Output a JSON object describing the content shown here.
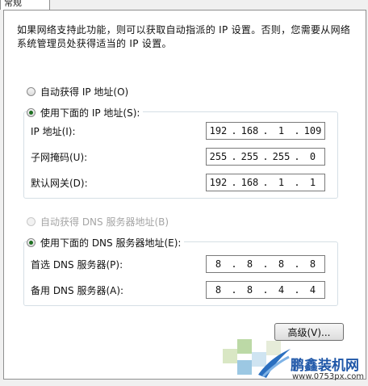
{
  "tab": {
    "label": "常规"
  },
  "description": "如果网络支持此功能，则可以获取自动指派的 IP 设置。否则，您需要从网络系统管理员处获得适当的 IP 设置。",
  "ip": {
    "auto_label": "自动获得 IP 地址(O)",
    "manual_label": "使用下面的 IP 地址(S):",
    "fields": [
      {
        "label": "IP 地址(I):",
        "octets": [
          "192",
          "168",
          "1",
          "109"
        ]
      },
      {
        "label": "子网掩码(U):",
        "octets": [
          "255",
          "255",
          "255",
          "0"
        ]
      },
      {
        "label": "默认网关(D):",
        "octets": [
          "192",
          "168",
          "1",
          "1"
        ]
      }
    ]
  },
  "dns": {
    "auto_label": "自动获得 DNS 服务器地址(B)",
    "manual_label": "使用下面的 DNS 服务器地址(E):",
    "fields": [
      {
        "label": "首选 DNS 服务器(P):",
        "octets": [
          "8",
          "8",
          "8",
          "8"
        ]
      },
      {
        "label": "备用 DNS 服务器(A):",
        "octets": [
          "8",
          "8",
          "4",
          "4"
        ]
      }
    ]
  },
  "advanced_button": "高级(V)...",
  "watermark": {
    "title": "鹏鑫装机网",
    "url": "www.0753px.com"
  },
  "colors": {
    "radio_dot": "#1e6f21",
    "group_border": "#d5dfe5",
    "watermark_blue": "#1f57a8"
  }
}
